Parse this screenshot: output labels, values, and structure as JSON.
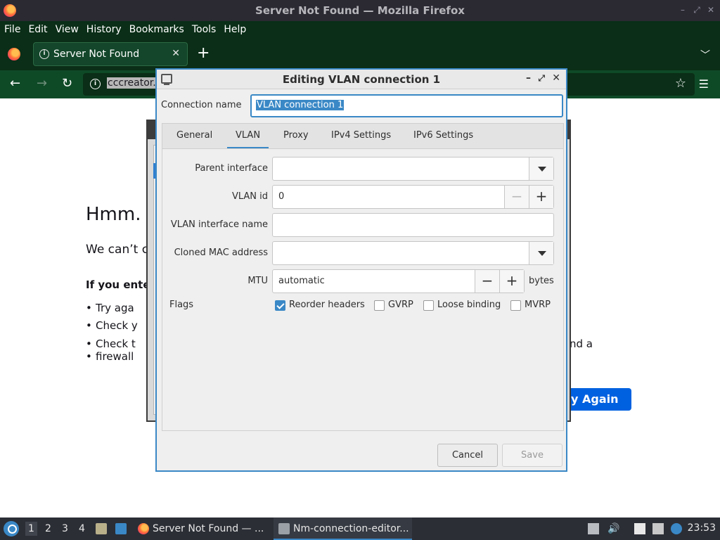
{
  "window": {
    "title": "Server Not Found — Mozilla Firefox"
  },
  "menubar": [
    "File",
    "Edit",
    "View",
    "History",
    "Bookmarks",
    "Tools",
    "Help"
  ],
  "tab": {
    "label": "Server Not Found",
    "close": "✕",
    "new": "+"
  },
  "urlbar": {
    "text": "cccreator."
  },
  "error_page": {
    "heading": "Hmm.",
    "message": "We can’t c",
    "bold_line": "If you ente",
    "items": [
      "Try aga",
      "Check y",
      "Check t"
    ],
    "item3_cont": "firewall",
    "tail": "nd a",
    "try_again": "y Again"
  },
  "dialog": {
    "title": "Editing VLAN connection 1",
    "connection_name_label": "Connection name",
    "connection_name_value": "VLAN connection 1",
    "tabs": [
      "General",
      "VLAN",
      "Proxy",
      "IPv4 Settings",
      "IPv6 Settings"
    ],
    "active_tab": "VLAN",
    "fields": {
      "parent_interface_label": "Parent interface",
      "parent_interface_value": "",
      "vlan_id_label": "VLAN id",
      "vlan_id_value": "0",
      "vlan_interface_name_label": "VLAN interface name",
      "vlan_interface_name_value": "",
      "cloned_mac_label": "Cloned MAC address",
      "cloned_mac_value": "",
      "mtu_label": "MTU",
      "mtu_value": "automatic",
      "mtu_unit": "bytes"
    },
    "flags_label": "Flags",
    "flags": [
      {
        "label": "Reorder headers",
        "checked": true
      },
      {
        "label": "GVRP",
        "checked": false
      },
      {
        "label": "Loose binding",
        "checked": false
      },
      {
        "label": "MVRP",
        "checked": false
      }
    ],
    "buttons": {
      "cancel": "Cancel",
      "save": "Save"
    }
  },
  "taskbar": {
    "workspaces": [
      "1",
      "2",
      "3",
      "4"
    ],
    "tasks": [
      "Server Not Found — ...",
      "Nm-connection-editor..."
    ],
    "clock": "23:53"
  }
}
